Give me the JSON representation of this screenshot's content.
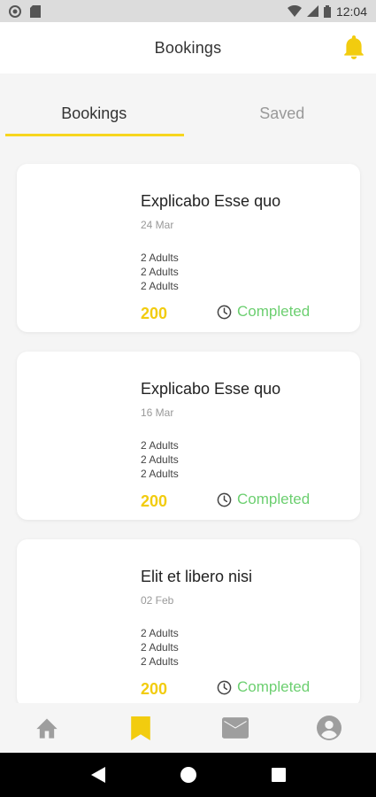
{
  "statusbar": {
    "time": "12:04"
  },
  "appbar": {
    "title": "Bookings"
  },
  "tabs": [
    {
      "label": "Bookings",
      "active": true
    },
    {
      "label": "Saved",
      "active": false
    }
  ],
  "bookings": [
    {
      "title": "Explicabo Esse quo",
      "date": "24 Mar",
      "guests": [
        "2 Adults",
        "2 Adults",
        "2 Adults"
      ],
      "price": "200",
      "status": "Completed"
    },
    {
      "title": "Explicabo Esse quo",
      "date": "16 Mar",
      "guests": [
        "2 Adults",
        "2 Adults",
        "2 Adults"
      ],
      "price": "200",
      "status": "Completed"
    },
    {
      "title": "Elit et libero nisi",
      "date": "02 Feb",
      "guests": [
        "2 Adults",
        "2 Adults",
        "2 Adults"
      ],
      "price": "200",
      "status": "Completed"
    }
  ],
  "bottom_nav": [
    {
      "icon": "home-icon",
      "active": false
    },
    {
      "icon": "bookmark-icon",
      "active": true
    },
    {
      "icon": "mail-icon",
      "active": false
    },
    {
      "icon": "account-icon",
      "active": false
    }
  ],
  "colors": {
    "accent": "#f2cc0f",
    "status_completed": "#6ccf70",
    "inactive_icon": "#9e9e9e"
  }
}
